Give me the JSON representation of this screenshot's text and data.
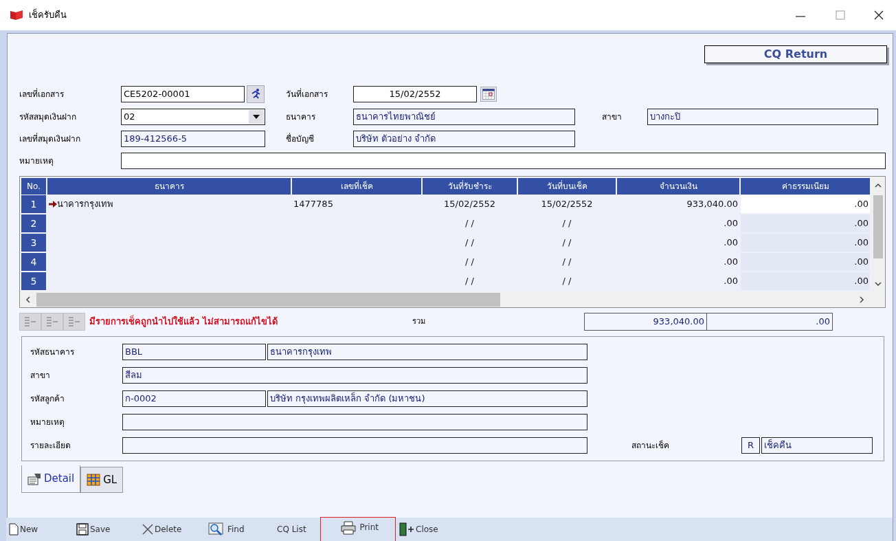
{
  "window": {
    "title": "เช็ครับคืน"
  },
  "header_button": "CQ Return",
  "form": {
    "doc_no": {
      "label": "เลขที่เอกสาร",
      "value": "CE5202-00001",
      "readonly": false
    },
    "doc_date": {
      "label": "วันที่เอกสาร",
      "value": "15/02/2552",
      "readonly": false
    },
    "book_code": {
      "label": "รหัสสมุดเงินฝาก",
      "value": "02",
      "readonly": false
    },
    "bank": {
      "label": "ธนาคาร",
      "value": "ธนาคารไทยพาณิชย์",
      "readonly": true
    },
    "branch": {
      "label": "สาขา",
      "value": "บางกะปิ",
      "readonly": true
    },
    "book_no": {
      "label": "เลขที่สมุดเงินฝาก",
      "value": "189-412566-5",
      "readonly": true
    },
    "account_name": {
      "label": "ชื่อบัญชี",
      "value": "บริษัท ตัวอย่าง จำกัด",
      "readonly": true
    },
    "remarks": {
      "label": "หมายเหตุ",
      "readonly": false
    }
  },
  "grid": {
    "columns": [
      "No.",
      "ธนาคาร",
      "เลขที่เช็ค",
      "วันที่รับชำระ",
      "วันที่บนเช็ค",
      "จำนวนเงิน",
      "ค่าธรรมเนียม"
    ],
    "rows": [
      {
        "selected": true,
        "cells": [
          "1",
          "นาคารกรุงเทพ",
          "1477785",
          "15/02/2552",
          "15/02/2552",
          "933,040.00",
          ".00"
        ]
      },
      {
        "selected": false,
        "cells": [
          "2",
          "",
          "",
          "/ /",
          "/ /",
          ".00",
          ".00"
        ]
      },
      {
        "selected": false,
        "cells": [
          "3",
          "",
          "",
          "/ /",
          "/ /",
          ".00",
          ".00"
        ]
      },
      {
        "selected": false,
        "cells": [
          "4",
          "",
          "",
          "/ /",
          "/ /",
          ".00",
          ".00"
        ]
      },
      {
        "selected": false,
        "cells": [
          "5",
          "",
          "",
          "/ /",
          "/ /",
          ".00",
          ".00"
        ]
      }
    ]
  },
  "message": "มีรายการเช็คถูกนำไปใช้แล้ว ไม่สามารถแก้ไขได้",
  "total": {
    "label": "รวม",
    "amount": "933,040.00",
    "fee": ".00"
  },
  "detail": {
    "rows": [
      {
        "label": "รหัสธนาคาร",
        "code": "BBL",
        "name": "ธนาคารกรุงเทพ"
      },
      {
        "label": "สาขา",
        "value": "สีลม"
      },
      {
        "label": "รหัสลูกค้า",
        "code": "ก-0002",
        "name": "บริษัท กรุงเทพผลิตเหล็ก จำกัด (มหาชน)"
      },
      {
        "label": "หมายเหตุ"
      },
      {
        "label": "รายละเอียด"
      }
    ],
    "status_label": "สถานะเช็ค",
    "status_code": "R",
    "status_text": "เช็คคืน"
  },
  "tabs": [
    {
      "label": "Detail",
      "selected": true,
      "kind": "detail"
    },
    {
      "label": "GL",
      "selected": false,
      "kind": "grid"
    }
  ],
  "toolbar": [
    {
      "label": "New",
      "kind": "new"
    },
    {
      "label": "Save",
      "kind": "save"
    },
    {
      "label": "Delete",
      "kind": "delete"
    },
    {
      "label": "Find",
      "kind": "find"
    },
    {
      "label": "CQ List",
      "kind": "text"
    },
    {
      "label": "Print",
      "kind": "print",
      "highlighted": true
    },
    {
      "label": "Close",
      "kind": "close"
    }
  ]
}
